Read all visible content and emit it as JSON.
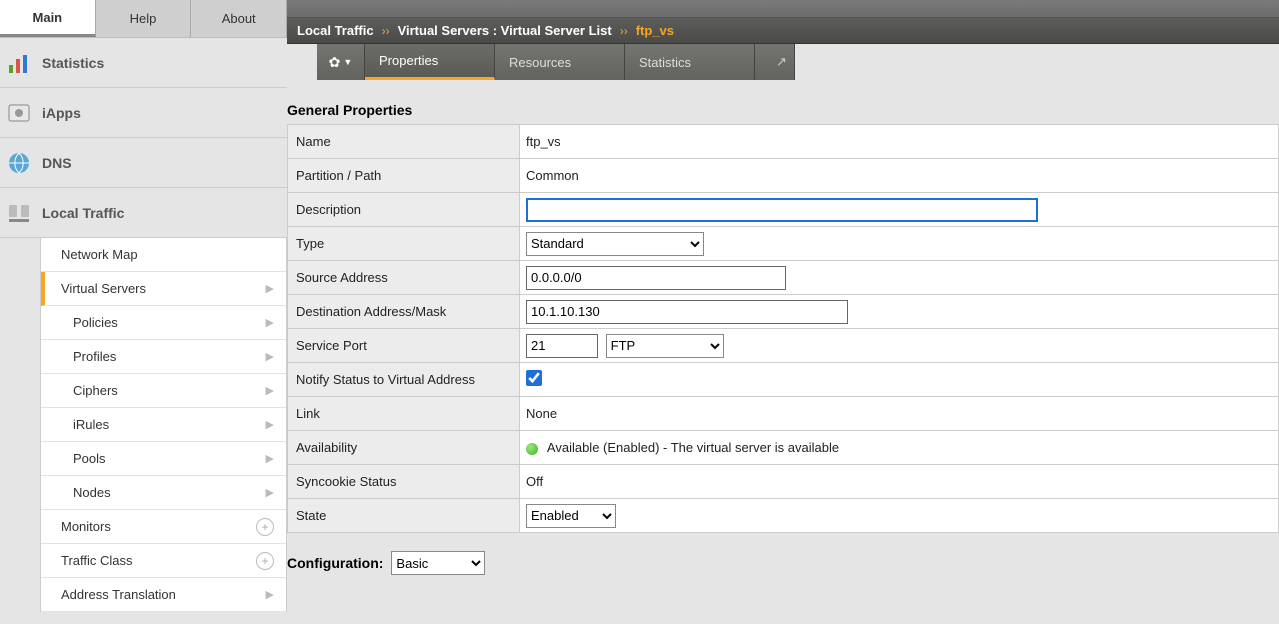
{
  "top_tabs": {
    "main": "Main",
    "help": "Help",
    "about": "About"
  },
  "nav": {
    "statistics": "Statistics",
    "iapps": "iApps",
    "dns": "DNS",
    "local_traffic": "Local Traffic"
  },
  "subnav": {
    "network_map": "Network Map",
    "virtual_servers": "Virtual Servers",
    "policies": "Policies",
    "profiles": "Profiles",
    "ciphers": "Ciphers",
    "irules": "iRules",
    "pools": "Pools",
    "nodes": "Nodes",
    "monitors": "Monitors",
    "traffic_class": "Traffic Class",
    "address_translation": "Address Translation"
  },
  "breadcrumb": {
    "part1": "Local Traffic",
    "part2": "Virtual Servers : Virtual Server List",
    "current": "ftp_vs"
  },
  "sub_tabs": {
    "properties": "Properties",
    "resources": "Resources",
    "statistics": "Statistics"
  },
  "section": {
    "general_properties": "General Properties",
    "configuration": "Configuration:"
  },
  "labels": {
    "name": "Name",
    "partition": "Partition / Path",
    "description": "Description",
    "type": "Type",
    "source_address": "Source Address",
    "dest": "Destination Address/Mask",
    "service_port": "Service Port",
    "notify": "Notify Status to Virtual Address",
    "link": "Link",
    "availability": "Availability",
    "syncookie": "Syncookie Status",
    "state": "State"
  },
  "values": {
    "name": "ftp_vs",
    "partition": "Common",
    "description": "",
    "type": "Standard",
    "source_address": "0.0.0.0/0",
    "dest": "10.1.10.130",
    "service_port": "21",
    "service_port_name": "FTP",
    "notify_checked": true,
    "link": "None",
    "availability": "Available (Enabled) - The virtual server is available",
    "syncookie": "Off",
    "state": "Enabled",
    "configuration_mode": "Basic"
  }
}
